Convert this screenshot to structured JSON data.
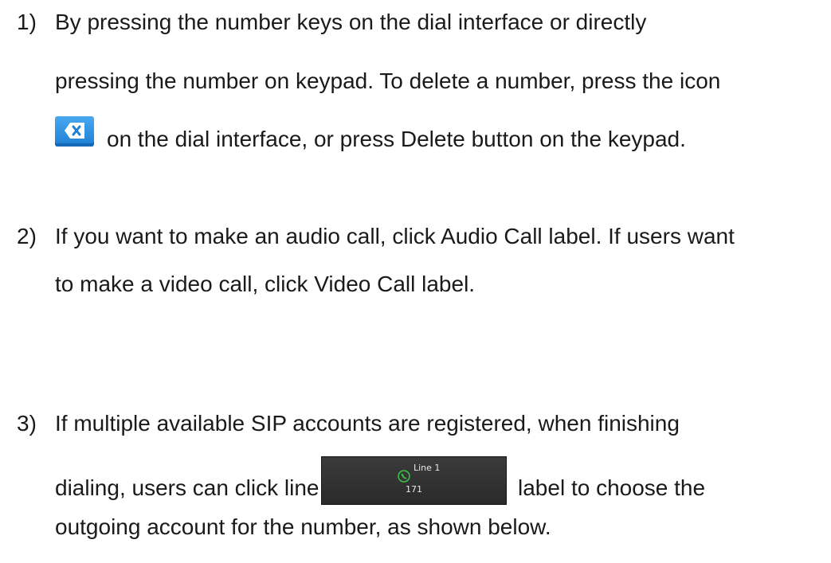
{
  "steps": [
    {
      "num": "1)",
      "lines": [
        "By pressing the number keys on the dial interface or directly",
        "pressing the number on keypad. To delete a number, press the icon",
        "on the dial interface, or press Delete button on the keypad."
      ]
    },
    {
      "num": "2)",
      "lines": [
        "If you want to make an audio call, click Audio Call label. If users want",
        "to make a video call, click Video Call label."
      ]
    },
    {
      "num": "3)",
      "lines": [
        "If multiple available SIP accounts are registered, when finishing",
        "dialing, users can click line",
        "label to choose the",
        "outgoing account for the number, as shown below."
      ]
    }
  ],
  "line_button": {
    "name": "Line 1",
    "number": "171"
  },
  "colors": {
    "text": "#1a1a1a",
    "icon_blue": "#1d7fd6",
    "button_bg": "#2f2f2f",
    "phone_green": "#3cc44a"
  },
  "icons": {
    "delete": "backspace-delete-icon",
    "phone": "phone-icon"
  }
}
